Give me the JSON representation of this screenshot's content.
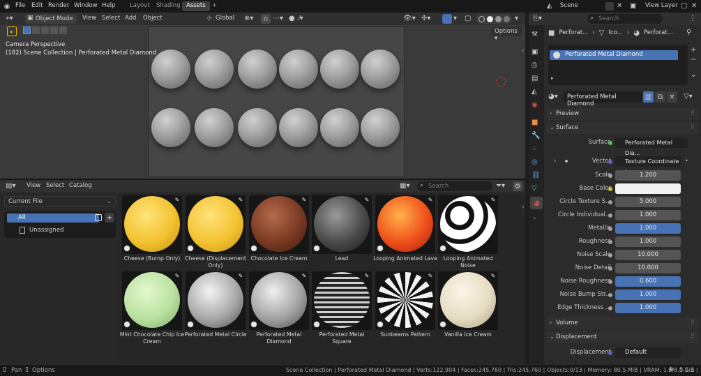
{
  "menu": [
    "File",
    "Edit",
    "Render",
    "Window",
    "Help"
  ],
  "workspaces": {
    "layout": "Layout",
    "shading": "Shading",
    "assets": "Assets",
    "add": "+"
  },
  "top_right": {
    "scene": "Scene",
    "view_layer": "View Layer"
  },
  "viewport": {
    "mode": "Object Mode",
    "view": "View",
    "select": "Select",
    "add": "Add",
    "object": "Object",
    "orientation": "Global",
    "options": "Options",
    "camera_label": "Camera Perspective",
    "collection_label": "(182) Scene Collection | Perforated Metal Diamond"
  },
  "asset_browser": {
    "view": "View",
    "select": "Select",
    "catalog": "Catalog",
    "library": "Current File",
    "search_placeholder": "Search",
    "catalogs": [
      {
        "label": "All",
        "selected": true
      },
      {
        "label": "Unassigned",
        "selected": false
      }
    ],
    "assets": [
      {
        "label": "Cheese (Bump Only)",
        "style": "cheese"
      },
      {
        "label": "Cheese (Displacement Only)",
        "style": "cheese2"
      },
      {
        "label": "Chocolate Ice Cream",
        "style": "choc"
      },
      {
        "label": "Lead",
        "style": "lead"
      },
      {
        "label": "Looping Animated Lava",
        "style": "lava"
      },
      {
        "label": "Looping Animated Noise",
        "style": "noise"
      },
      {
        "label": "Mint Chocolate Chip Ice Cream",
        "style": "mint"
      },
      {
        "label": "Perforated Metal Circle",
        "style": "metalc"
      },
      {
        "label": "Perforated Metal Diamond",
        "style": "metald"
      },
      {
        "label": "Perforated Metal Square",
        "style": "metals"
      },
      {
        "label": "Sunbeams Pattern",
        "style": "sun"
      },
      {
        "label": "Vanilla Ice Cream",
        "style": "vanilla"
      }
    ]
  },
  "properties": {
    "search_placeholder": "Search",
    "breadcrumb": [
      "Perforat...",
      "Ico...",
      "Perforat..."
    ],
    "slot": "Perforated Metal Diamond",
    "material_name": "Perforated Metal Diamond",
    "sections": {
      "preview": "Preview",
      "surface": "Surface",
      "volume": "Volume",
      "displacement": "Displacement"
    },
    "surface_row": {
      "label": "Surface",
      "value": "Perforated Metal Dia..."
    },
    "vector_row": {
      "label": "Vector",
      "value": "Texture Coordinate | ..."
    },
    "rows": [
      {
        "label": "Scale",
        "value": "1.200",
        "style": "grey"
      },
      {
        "label": "Base Color",
        "value": "",
        "style": "white"
      },
      {
        "label": "Circle Texture S...",
        "value": "5.000",
        "style": "grey"
      },
      {
        "label": "Circle Individual...",
        "value": "1.000",
        "style": "grey"
      },
      {
        "label": "Metallic",
        "value": "1.000",
        "style": "blue"
      },
      {
        "label": "Roughness",
        "value": "1.000",
        "style": "grey"
      },
      {
        "label": "Noise Scale",
        "value": "10.000",
        "style": "grey"
      },
      {
        "label": "Noise Detail",
        "value": "10.000",
        "style": "grey"
      },
      {
        "label": "Noise Roughness",
        "value": "0.600",
        "style": "blue"
      },
      {
        "label": "Noise Bump Str...",
        "value": "1.000",
        "style": "blue"
      },
      {
        "label": "Edge Thickness ...",
        "value": "1.000",
        "style": "blue"
      }
    ],
    "displacement_row": {
      "label": "Displacement",
      "value": "Default"
    }
  },
  "status": {
    "pan": "Pan",
    "options": "Options",
    "info": "Scene Collection | Perforated Metal Diamond | Verts:122,904 | Faces:245,760 | Tris:245,760 | Objects:0/13 | Memory: 80.5 MiB | VRAM: 1.3/8.0 GiB |",
    "version": "5.1.1"
  },
  "colors": {
    "accent": "#4772b3",
    "selected_bg": "#4772b3",
    "panel": "#2b2b2b"
  }
}
